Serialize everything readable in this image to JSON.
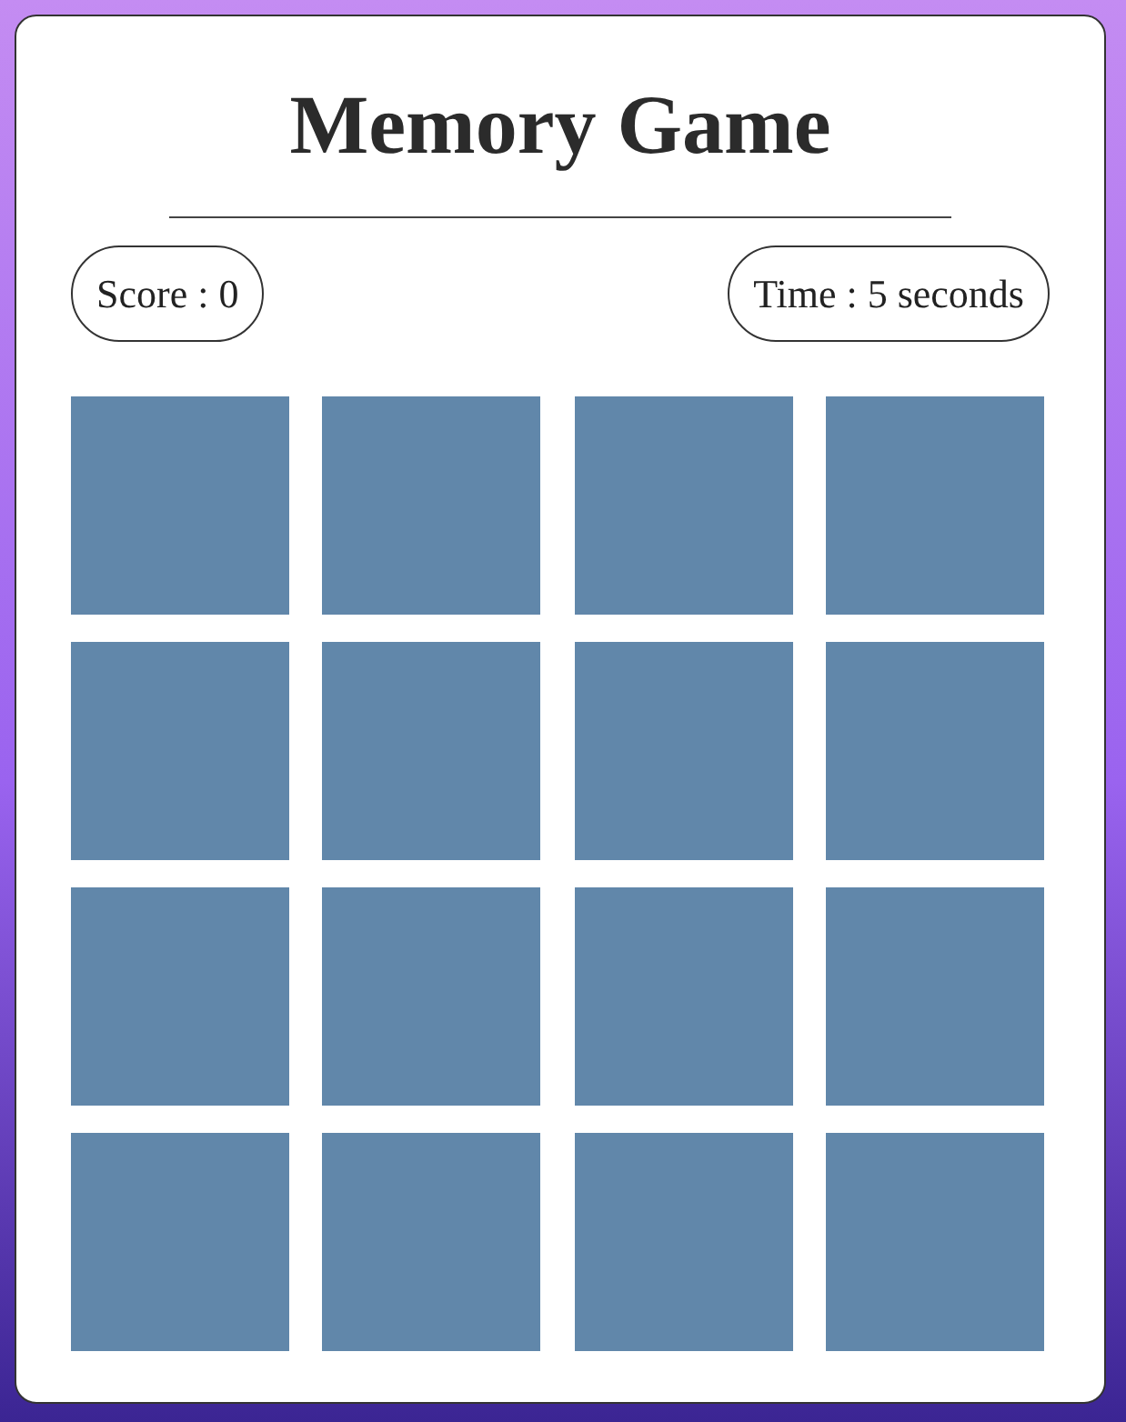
{
  "title": "Memory Game",
  "score": "Score : 0",
  "time": "Time : 5 seconds",
  "cards": [
    {
      "face_up": false
    },
    {
      "face_up": false
    },
    {
      "face_up": false
    },
    {
      "face_up": false
    },
    {
      "face_up": false
    },
    {
      "face_up": false
    },
    {
      "face_up": false
    },
    {
      "face_up": false
    },
    {
      "face_up": false
    },
    {
      "face_up": false
    },
    {
      "face_up": false
    },
    {
      "face_up": false
    },
    {
      "face_up": false
    },
    {
      "face_up": false
    },
    {
      "face_up": false
    },
    {
      "face_up": false
    }
  ]
}
